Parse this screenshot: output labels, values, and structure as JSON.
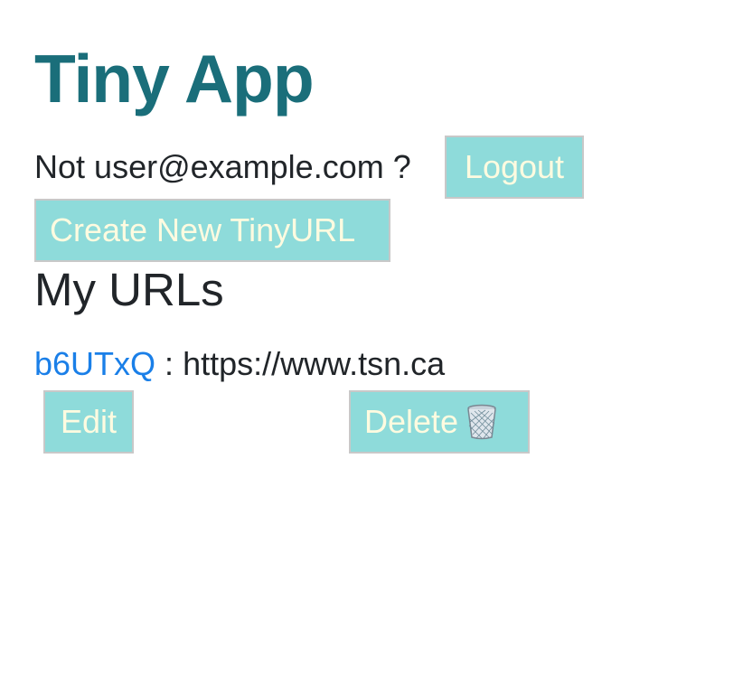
{
  "header": {
    "title": "Tiny App",
    "user_prefix": "Not",
    "user_email": "user@example.com",
    "user_suffix": "?",
    "logout_label": "Logout"
  },
  "actions": {
    "create_label": "Create New TinyURL"
  },
  "main": {
    "section_title": "My URLs",
    "urls": [
      {
        "short": "b6UTxQ",
        "separator": " : ",
        "long": "https://www.tsn.ca",
        "edit_label": "Edit",
        "delete_label": "Delete",
        "delete_icon": "trash-icon"
      }
    ]
  },
  "colors": {
    "title": "#1a6e7a",
    "button_bg": "#8edbda",
    "button_text": "#fffbe0",
    "link": "#1a7fe8"
  }
}
